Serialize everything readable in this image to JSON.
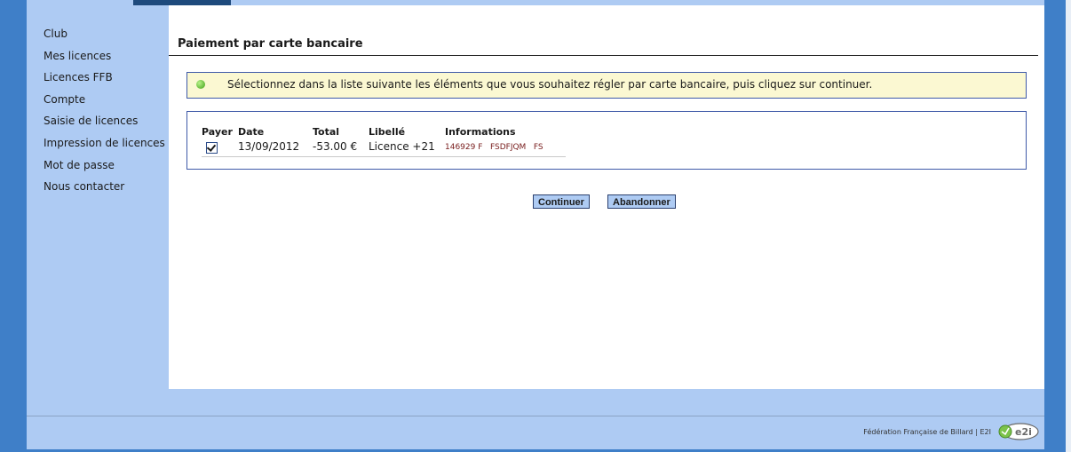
{
  "sidebar": {
    "items": [
      {
        "label": "Club"
      },
      {
        "label": "Mes licences"
      },
      {
        "label": "Licences FFB"
      },
      {
        "label": "Compte"
      },
      {
        "label": "Saisie de licences"
      },
      {
        "label": "Impression de licences"
      },
      {
        "label": "Mot de passe"
      },
      {
        "label": "Nous contacter"
      }
    ]
  },
  "main": {
    "title": "Paiement par carte bancaire",
    "info": {
      "icon": "info-icon",
      "text": "Sélectionnez dans la liste suivante les éléments que vous souhaitez régler par carte bancaire, puis cliquez sur continuer."
    },
    "table": {
      "headers": {
        "payer": "Payer",
        "date": "Date",
        "total": "Total",
        "libelle": "Libellé",
        "informations": "Informations"
      },
      "rows": [
        {
          "payer_checked": true,
          "date": "13/09/2012",
          "total": "-53.00 €",
          "libelle": "Licence +21",
          "informations": "146929 F   FSDFJQM   FS"
        }
      ]
    },
    "buttons": {
      "continue_label": "Continuer",
      "abandon_label": "Abandonner"
    }
  },
  "footer": {
    "text": "Fédération Française de Billard | E2I",
    "logo_text": "e2i"
  },
  "colors": {
    "frame_blue": "#3f7fc8",
    "panel_light_blue": "#aecbf3",
    "info_bg": "#fbf8d2",
    "border_blue": "#3f5aa8"
  }
}
